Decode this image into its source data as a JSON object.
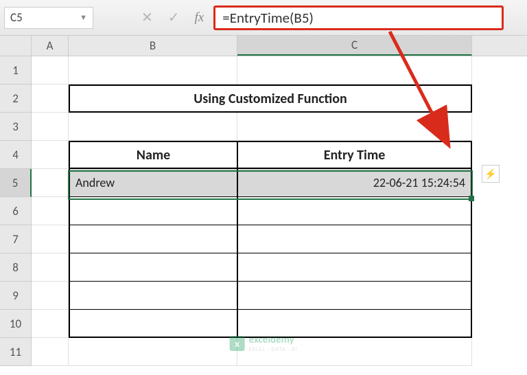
{
  "formula_bar": {
    "cell_ref": "C5",
    "formula": "=EntryTime(B5)"
  },
  "columns": [
    "A",
    "B",
    "C"
  ],
  "rows": [
    "1",
    "2",
    "3",
    "4",
    "5",
    "6",
    "7",
    "8",
    "9",
    "10",
    "11"
  ],
  "sheet": {
    "title": "Using Customized Function",
    "header_name": "Name",
    "header_time": "Entry Time",
    "entry_name": "Andrew",
    "entry_time": "22-06-21 15:24:54"
  },
  "watermark": {
    "brand": "exceldemy",
    "sub": "EXCEL · DATA · BI"
  },
  "icons": {
    "dropdown": "▼",
    "cancel": "✕",
    "check": "✓",
    "fx": "fx",
    "smart": "⚡"
  }
}
